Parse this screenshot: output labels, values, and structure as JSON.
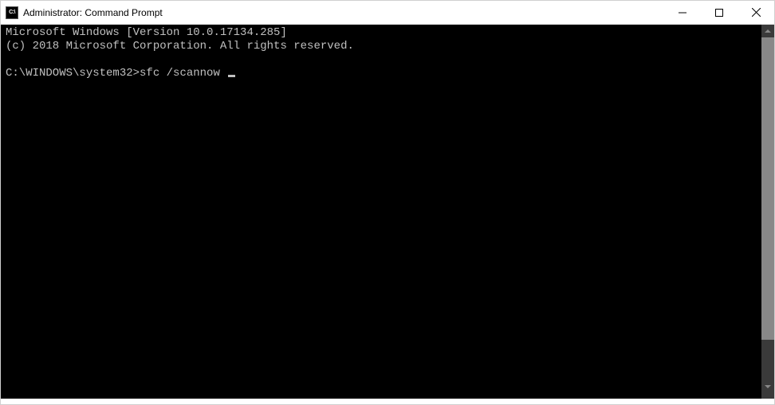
{
  "window": {
    "title": "Administrator: Command Prompt"
  },
  "terminal": {
    "line1": "Microsoft Windows [Version 10.0.17134.285]",
    "line2": "(c) 2018 Microsoft Corporation. All rights reserved.",
    "blank": "",
    "prompt": "C:\\WINDOWS\\system32>",
    "command": "sfc /scannow"
  }
}
